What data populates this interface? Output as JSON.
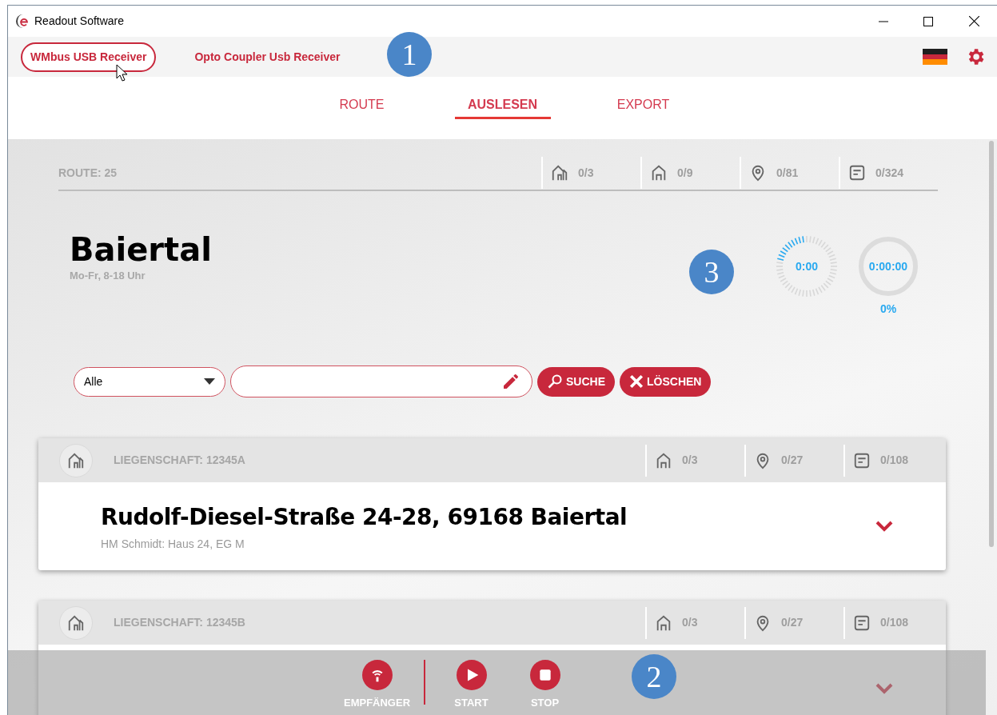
{
  "window": {
    "title": "Readout Software"
  },
  "receivers": [
    {
      "label": "WMbus USB Receiver",
      "selected": true
    },
    {
      "label": "Opto Coupler Usb Receiver",
      "selected": false
    }
  ],
  "tabs": [
    {
      "label": "ROUTE",
      "selected": false
    },
    {
      "label": "AUSLESEN",
      "selected": true
    },
    {
      "label": "EXPORT",
      "selected": false
    }
  ],
  "route": {
    "label": "ROUTE: 25",
    "stats": [
      {
        "kind": "building",
        "value": "0/3"
      },
      {
        "kind": "house",
        "value": "0/9"
      },
      {
        "kind": "pin",
        "value": "0/81"
      },
      {
        "kind": "note",
        "value": "0/324"
      }
    ]
  },
  "location": {
    "title": "Baiertal",
    "hours": "Mo-Fr, 8-18 Uhr"
  },
  "timers": {
    "elapsed": "0:00",
    "total": "0:00:00",
    "percent": "0%",
    "level": 0
  },
  "filter": {
    "select": "Alle"
  },
  "filter_buttons": [
    {
      "kind": "search",
      "label": "SUCHE"
    },
    {
      "kind": "clear",
      "label": "LÖSCHEN"
    }
  ],
  "properties": [
    {
      "label": "LIEGENSCHAFT: 12345A",
      "stats": [
        {
          "kind": "house",
          "value": "0/3"
        },
        {
          "kind": "pin",
          "value": "0/27"
        },
        {
          "kind": "note",
          "value": "0/108"
        }
      ],
      "address": "Rudolf-Diesel-Straße 24-28, 69168 Baiertal",
      "note": "HM Schmidt: Haus 24, EG M",
      "expanded": false
    },
    {
      "label": "LIEGENSCHAFT: 12345B",
      "stats": [
        {
          "kind": "house",
          "value": "0/3"
        },
        {
          "kind": "pin",
          "value": "0/27"
        },
        {
          "kind": "note",
          "value": "0/108"
        }
      ],
      "expanded": false
    }
  ],
  "bottom_bar": [
    {
      "kind": "receiver",
      "label": "EMPFÄNGER"
    },
    {
      "kind": "start",
      "label": "START"
    },
    {
      "kind": "stop",
      "label": "STOP"
    }
  ],
  "callouts": [
    "1",
    "2",
    "3"
  ]
}
